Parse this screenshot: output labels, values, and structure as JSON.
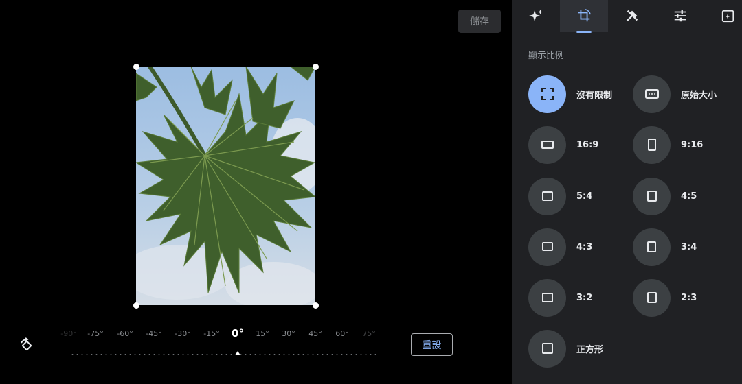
{
  "editor": {
    "save_label": "儲存",
    "reset_label": "重設",
    "angle_labels": [
      "-90°",
      "-75°",
      "-60°",
      "-45°",
      "-30°",
      "-15°",
      "0°",
      "15°",
      "30°",
      "45°",
      "60°",
      "75°"
    ],
    "current_angle": "0°"
  },
  "panel": {
    "tabs": [
      {
        "icon": "sparkle-icon",
        "active": false
      },
      {
        "icon": "crop-rotate-icon",
        "active": true
      },
      {
        "icon": "tools-icon",
        "active": false
      },
      {
        "icon": "adjust-sliders-icon",
        "active": false
      },
      {
        "icon": "markup-icon",
        "active": false
      }
    ],
    "section_title": "顯示比例",
    "ratios": [
      {
        "label": "沒有限制",
        "icon": "free-crop-icon",
        "selected": true
      },
      {
        "label": "原始大小",
        "icon": "original-ratio-icon",
        "selected": false
      },
      {
        "label": "16:9",
        "icon": "landscape-rect-icon",
        "selected": false
      },
      {
        "label": "9:16",
        "icon": "portrait-rect-icon",
        "selected": false
      },
      {
        "label": "5:4",
        "icon": "landscape-rect-icon",
        "selected": false
      },
      {
        "label": "4:5",
        "icon": "portrait-rect-icon",
        "selected": false
      },
      {
        "label": "4:3",
        "icon": "landscape-rect-icon",
        "selected": false
      },
      {
        "label": "3:4",
        "icon": "portrait-rect-icon",
        "selected": false
      },
      {
        "label": "3:2",
        "icon": "landscape-rect-icon",
        "selected": false
      },
      {
        "label": "2:3",
        "icon": "portrait-rect-icon",
        "selected": false
      },
      {
        "label": "正方形",
        "icon": "square-icon",
        "selected": false
      }
    ]
  },
  "colors": {
    "accent": "#8ab4f8",
    "panel_bg": "#202124",
    "button_bg": "#3c4043"
  }
}
